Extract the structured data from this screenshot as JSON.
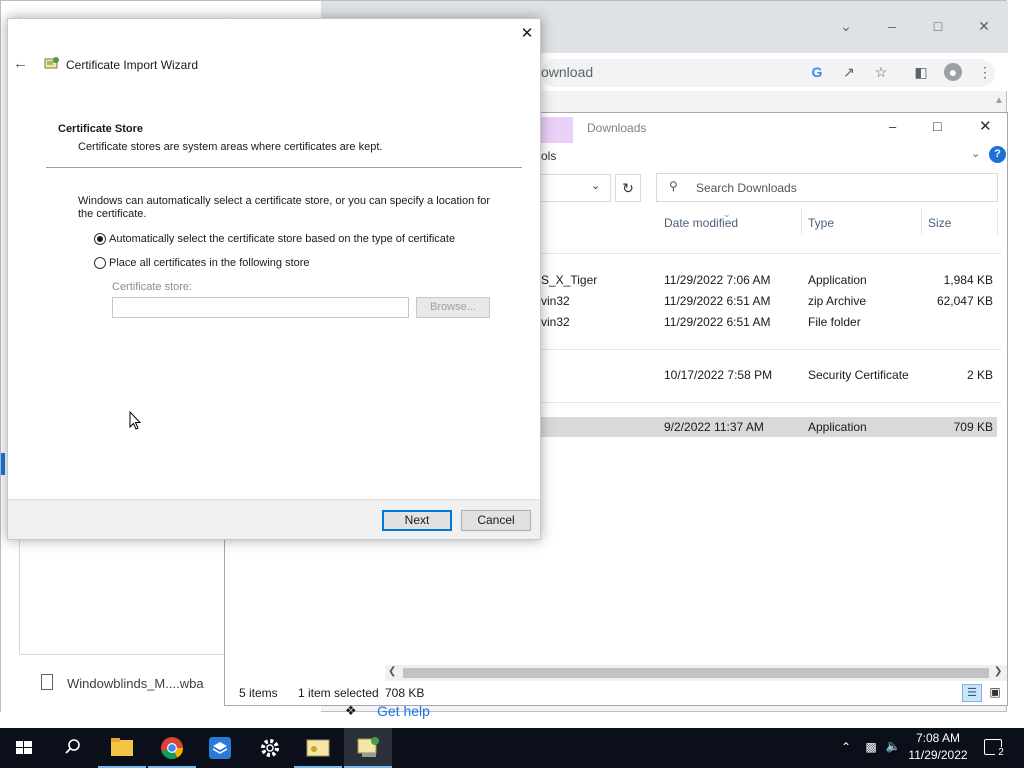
{
  "chrome": {
    "omnibox_text": "ownload",
    "get_help": "Get help",
    "download_item": "Windowblinds_M....wba"
  },
  "explorer": {
    "title": "Downloads",
    "ribbon_tab": "ols",
    "search_placeholder": "Search Downloads",
    "columns": [
      "Date modified",
      "Type",
      "Size"
    ],
    "rows": [
      {
        "name": "S_X_Tiger",
        "date": "11/29/2022 7:06 AM",
        "type": "Application",
        "size": "1,984 KB",
        "selected": false
      },
      {
        "name": "vin32",
        "date": "11/29/2022 6:51 AM",
        "type": "zip Archive",
        "size": "62,047 KB",
        "selected": false
      },
      {
        "name": "vin32",
        "date": "11/29/2022 6:51 AM",
        "type": "File folder",
        "size": "",
        "selected": false
      },
      {
        "name": "",
        "date": "10/17/2022 7:58 PM",
        "type": "Security Certificate",
        "size": "2 KB",
        "selected": false
      },
      {
        "name": "",
        "date": "9/2/2022 11:37 AM",
        "type": "Application",
        "size": "709 KB",
        "selected": true
      }
    ],
    "status": {
      "items": "5 items",
      "selected": "1 item selected",
      "size": "708 KB"
    }
  },
  "wizard": {
    "title": "Certificate Import Wizard",
    "section_title": "Certificate Store",
    "section_desc": "Certificate stores are system areas where certificates are kept.",
    "intro_line1": "Windows can automatically select a certificate store, or you can specify a location for",
    "intro_line2": "the certificate.",
    "option_auto": "Automatically select the certificate store based on the type of certificate",
    "option_manual": "Place all certificates in the following store",
    "store_label": "Certificate store:",
    "store_value": "",
    "browse_label": "Browse...",
    "next_label": "Next",
    "cancel_label": "Cancel",
    "selected_option": "auto"
  },
  "taskbar": {
    "time": "7:08 AM",
    "date": "11/29/2022",
    "notification_count": "2"
  },
  "colors": {
    "accent": "#0078d7",
    "taskbar": "#0a0f1a",
    "chrome_link": "#1a73e8"
  }
}
